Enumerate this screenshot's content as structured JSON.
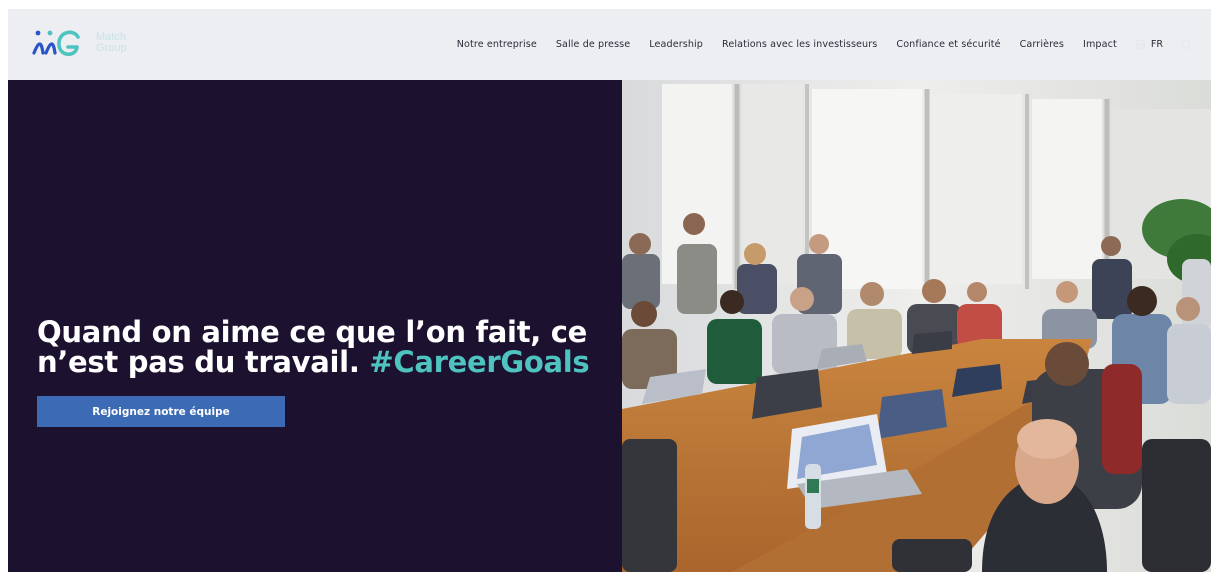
{
  "brand": {
    "name_line1": "Match",
    "name_line2": "Group",
    "colors": {
      "logo_blue": "#2b54c7",
      "logo_teal": "#4fc3c0",
      "logo_text": "#c9e3e8"
    }
  },
  "nav": {
    "items": [
      {
        "label": "Notre entreprise"
      },
      {
        "label": "Salle de presse"
      },
      {
        "label": "Leadership"
      },
      {
        "label": "Relations avec les investisseurs"
      },
      {
        "label": "Confiance et sécurité"
      },
      {
        "label": "Carrières"
      },
      {
        "label": "Impact"
      }
    ],
    "language": "FR",
    "language_icon": "globe-icon",
    "search_icon": "search-icon"
  },
  "hero": {
    "title_main": "Quand on aime ce que l’on fait, ce n’est pas du travail.",
    "title_hashtag": "#CareerGoals",
    "cta_label": "Rejoignez notre équipe",
    "colors": {
      "background": "#1d1130",
      "accent": "#4fc3c0",
      "button": "#3c6ab5"
    }
  }
}
